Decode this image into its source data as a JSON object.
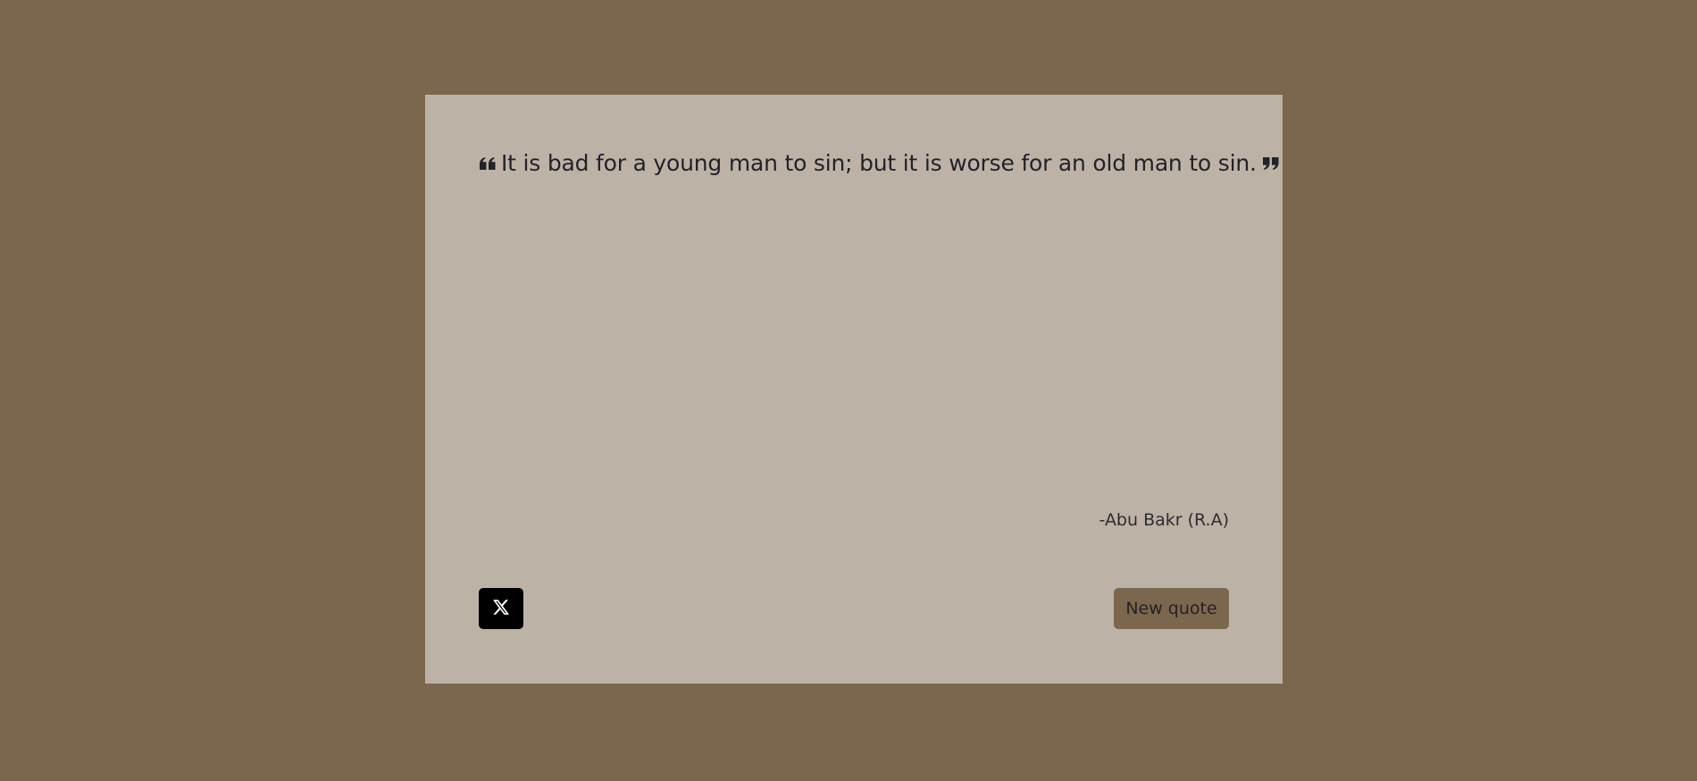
{
  "quote": {
    "text": "It is bad for a young man to sin; but it is worse for an old man to sin.",
    "author": "-Abu Bakr (R.A)",
    "open_icon": "quote-left-icon",
    "close_icon": "quote-right-icon"
  },
  "actions": {
    "tweet_icon": "x-logo-icon",
    "new_quote_label": "New quote"
  },
  "colors": {
    "page_background": "#7b674d",
    "card_background": "#bdb2a6",
    "text": "#22232a",
    "tweet_button": "#000000",
    "new_quote_button": "#7b674d"
  }
}
